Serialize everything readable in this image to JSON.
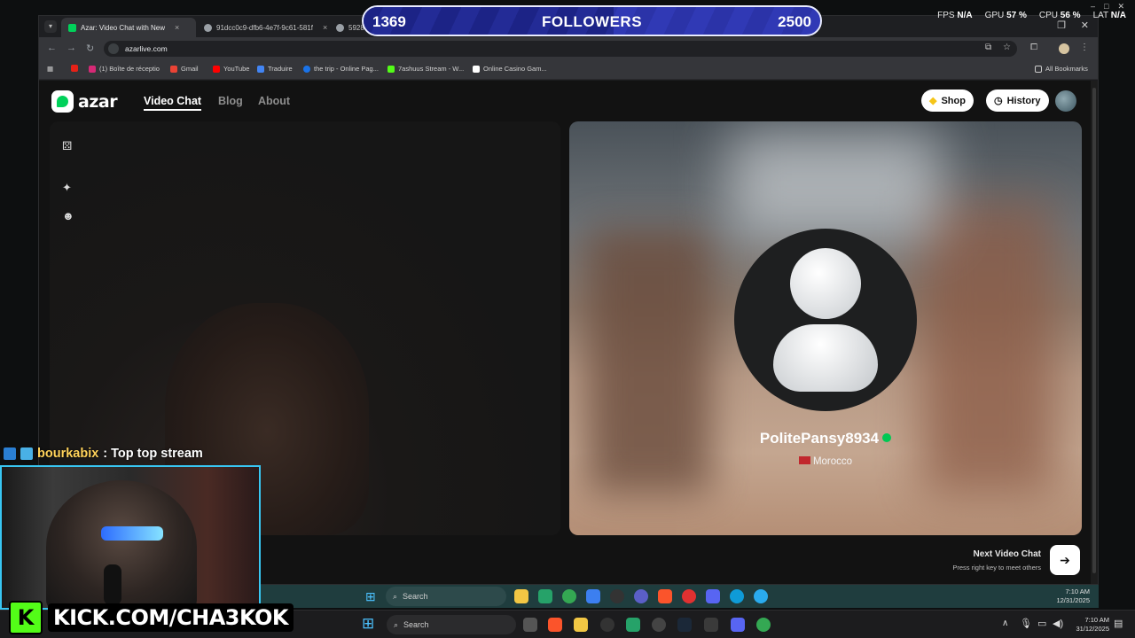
{
  "browser": {
    "tabs": [
      {
        "title": "Azar: Video Chat with New",
        "active": true
      },
      {
        "title": "91dcc0c9-dfb6-4e7f-9c61-581f",
        "active": false
      },
      {
        "title": "59282f",
        "active": false
      }
    ],
    "url": "azarlive.com",
    "bookmarks": [
      "(1) Boîte de réceptio",
      "Gmail",
      "YouTube",
      "Traduire",
      "the trip - Online Pag...",
      "7ashuus Stream - W...",
      "Online Casino Gam...",
      "All Bookmarks"
    ]
  },
  "azar": {
    "logo_text": "azar",
    "nav": [
      "Video Chat",
      "Blog",
      "About"
    ],
    "shop_label": "Shop",
    "history_label": "History",
    "peer": {
      "name": "PolitePansy8934",
      "country": "Morocco"
    },
    "next_title": "Next Video Chat",
    "next_hint": "Press right key to meet others"
  },
  "hud": {
    "followers_current": "1369",
    "followers_label": "FOLLOWERS",
    "followers_goal": "2500",
    "followers_progress": 0.5476,
    "fps_label": "FPS",
    "fps_value": "N/A",
    "gpu_label": "GPU",
    "gpu_value": "57 %",
    "cpu_label": "CPU",
    "cpu_value": "56 %",
    "lat_label": "LAT",
    "lat_value": "N/A"
  },
  "chat": {
    "user": "bourkabix",
    "message": ": Top top stream"
  },
  "banner": {
    "logo_letter": "K",
    "text": "KICK.COM/CHA3KOK"
  },
  "taskbars": {
    "inner_search": "Search",
    "inner_time": "7:10 AM",
    "inner_date": "12/31/2025",
    "outer_search": "Search",
    "outer_time": "7:10 AM",
    "outer_date": "31/12/2025"
  },
  "colors": {
    "azar_green": "#00d15a",
    "progress_fill": "#1c2386",
    "progress_bg": "#2b33a8",
    "webcam_border": "#38c6f2",
    "kick_green": "#53fc18"
  }
}
